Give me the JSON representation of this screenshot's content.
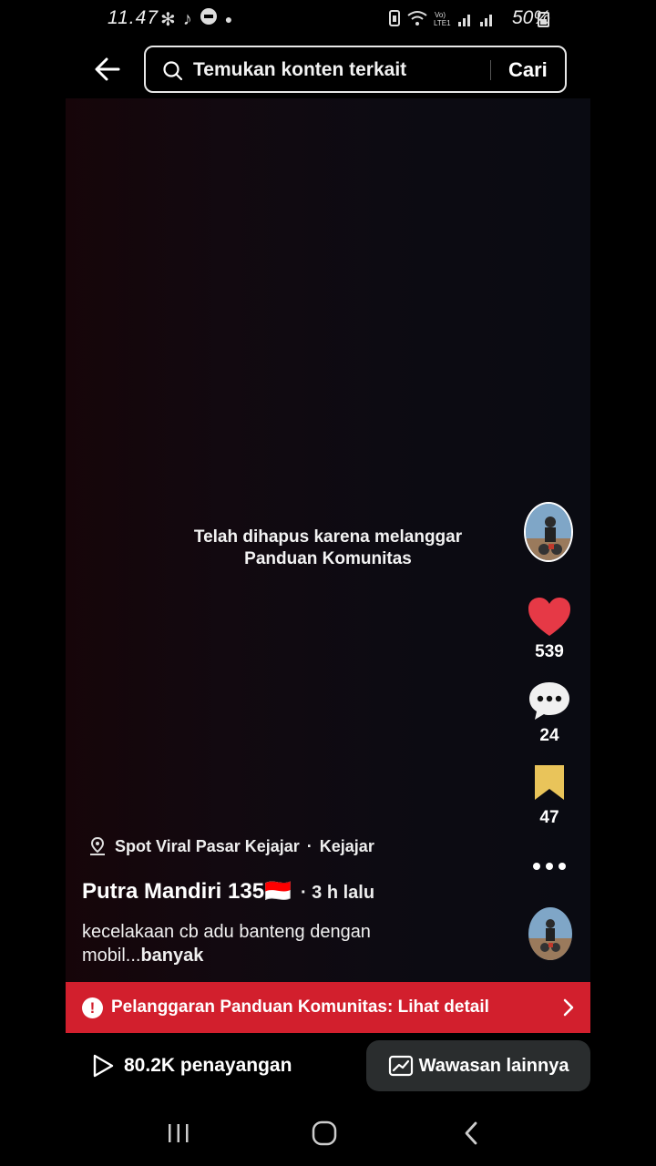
{
  "status_bar": {
    "time": "11.47",
    "battery": "50%"
  },
  "search": {
    "placeholder": "Temukan konten terkait",
    "submit_label": "Cari"
  },
  "video": {
    "removed_message_line1": "Telah dihapus karena melanggar",
    "removed_message_line2": "Panduan Komunitas"
  },
  "rail": {
    "likes": "539",
    "comments": "24",
    "saves": "47"
  },
  "post": {
    "location": "Spot Viral Pasar Kejajar",
    "location_sub": "Kejajar",
    "location_separator": "·",
    "username": "Putra Mandiri 135🇮🇩",
    "time": "· 3 h lalu",
    "caption": "kecelakaan cb adu banteng dengan mobil...",
    "caption_more": "banyak"
  },
  "violation": {
    "text": "Pelanggaran Panduan Komunitas: Lihat detail"
  },
  "stats": {
    "views": "80.2K penayangan",
    "insights_label": "Wawasan lainnya"
  },
  "colors": {
    "like": "#e63946",
    "save": "#e9c45a",
    "violation_bar": "#d21f2d",
    "insights_bg": "#2a2d2e"
  }
}
